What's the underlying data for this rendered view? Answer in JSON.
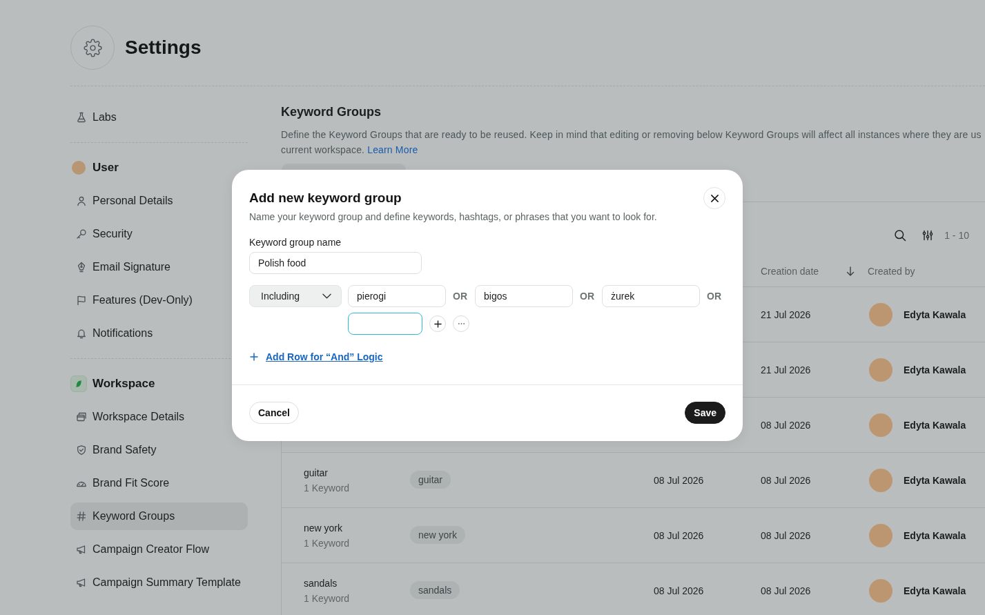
{
  "header": {
    "title": "Settings"
  },
  "sidebar": {
    "groups": [
      {
        "items": [
          {
            "label": "Labs",
            "selected": false
          }
        ]
      },
      {
        "heading": {
          "label": "User",
          "kind": "avatar"
        },
        "items": [
          {
            "label": "Personal Details",
            "selected": false
          },
          {
            "label": "Security",
            "selected": false
          },
          {
            "label": "Email Signature",
            "selected": false
          },
          {
            "label": "Features (Dev-Only)",
            "selected": false
          },
          {
            "label": "Notifications",
            "selected": false
          }
        ]
      },
      {
        "heading": {
          "label": "Workspace",
          "kind": "logo"
        },
        "items": [
          {
            "label": "Workspace Details",
            "selected": false
          },
          {
            "label": "Brand Safety",
            "selected": false
          },
          {
            "label": "Brand Fit Score",
            "selected": false
          },
          {
            "label": "Keyword Groups",
            "selected": true
          },
          {
            "label": "Campaign Creator Flow",
            "selected": false
          },
          {
            "label": "Campaign Summary Template",
            "selected": false
          }
        ]
      }
    ]
  },
  "page": {
    "title": "Keyword Groups",
    "description": [
      "Define the Keyword Groups that are ready to be reused. Keep in mind that editing or removing below Keyword Groups will affect all instances where they are us",
      "current workspace."
    ],
    "link": "Learn More"
  },
  "table": {
    "range": "1 - 10",
    "columns": [
      {
        "label": "Creation date",
        "sorted": true
      },
      {
        "label": "Created by",
        "sorted": false
      }
    ],
    "rows": [
      {
        "creation_date": "21 Jul 2026",
        "created_by": "Edyta Kawala"
      },
      {
        "creation_date": "21 Jul 2026",
        "created_by": "Edyta Kawala"
      },
      {
        "creation_date": "08 Jul 2026",
        "created_by": "Edyta Kawala"
      },
      {
        "name": "guitar",
        "count": "1 Keyword",
        "keywords": [
          "guitar"
        ],
        "column_3": "08 Jul 2026",
        "creation_date": "08 Jul 2026",
        "created_by": "Edyta Kawala"
      },
      {
        "name": "new york",
        "count": "1 Keyword",
        "keywords": [
          "new york"
        ],
        "column_3": "08 Jul 2026",
        "creation_date": "08 Jul 2026",
        "created_by": "Edyta Kawala"
      },
      {
        "name": "sandals",
        "count": "1 Keyword",
        "keywords": [
          "sandals"
        ],
        "column_3": "08 Jul 2026",
        "creation_date": "08 Jul 2026",
        "created_by": "Edyta Kawala"
      }
    ]
  },
  "dialog": {
    "title": "Add new keyword group",
    "subtitle": "Name your keyword group and define keywords, hashtags, or phrases that you want to look for.",
    "name_field": {
      "label": "Keyword group name",
      "value": "Polish food"
    },
    "operator": "Including",
    "keywords": [
      {
        "value": "pierogi",
        "joiner": "OR"
      },
      {
        "value": "bigos",
        "joiner": "OR"
      },
      {
        "value": "żurek",
        "joiner": "OR"
      }
    ],
    "new_keyword": {
      "focused": true
    },
    "add_row_link": "Add Row for “And” Logic",
    "buttons": [
      {
        "label": "Cancel",
        "kind": "secondary"
      },
      {
        "label": "Save",
        "kind": "primary"
      }
    ]
  }
}
